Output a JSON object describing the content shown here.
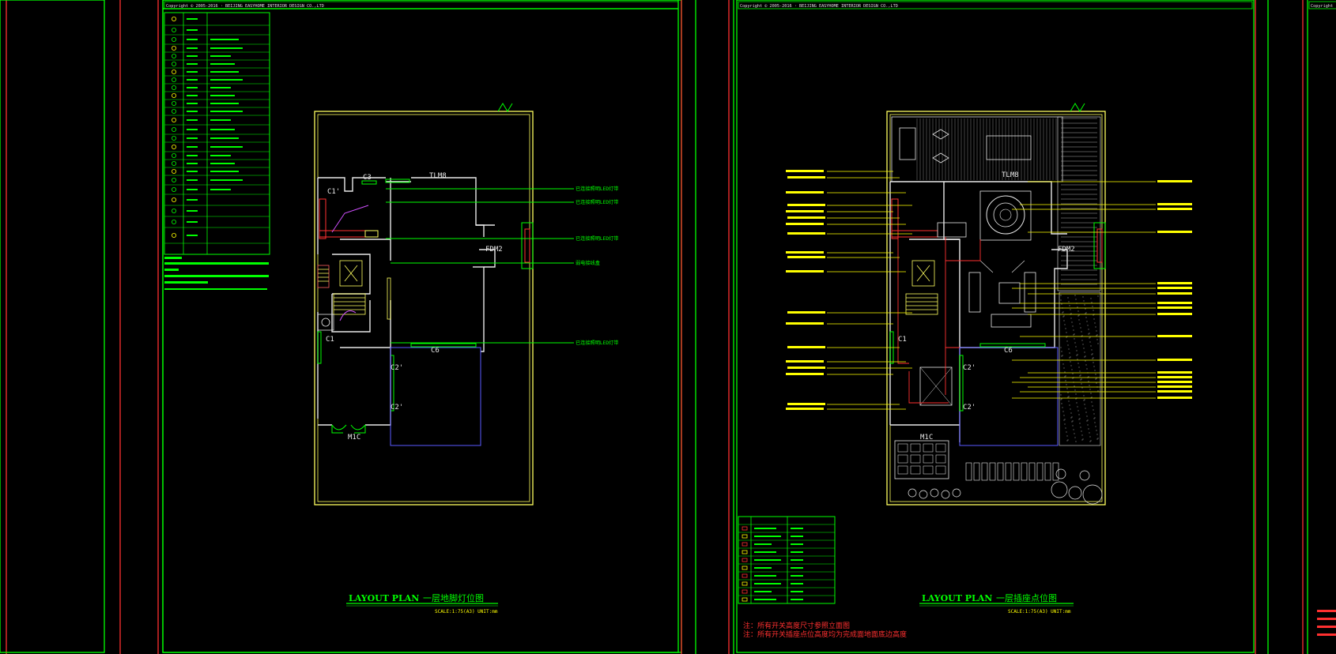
{
  "sheet_left": {
    "copyright": "Copyright ©  2005-2016 · BEIJING EASYHOME  INTERIOR DESIGN CO.,LTD",
    "title_en": "LAYOUT PLAN",
    "title_cn": "一层地脚灯位图",
    "scale": "SCALE:1:75(A3)  UNIT:mm",
    "room_labels": {
      "tlm8": "TLM8",
      "c3": "C3",
      "c1a": "C1'",
      "fdm2": "FDM2",
      "c1": "C1",
      "c6": "C6",
      "c2a": "C2'",
      "c2b": "C2'",
      "m1c": "M1C"
    },
    "callouts": [
      "已连接照明LED灯带",
      "已连接照明LED灯带",
      "已连接照明LED灯带",
      "弱电接线盒",
      "已连接照明LED灯带"
    ]
  },
  "sheet_right": {
    "copyright": "Copyright ©  2005-2016 · BEIJING EASYHOME  INTERIOR DESIGN CO.,LTD",
    "title_en": "LAYOUT PLAN",
    "title_cn": "一层插座点位图",
    "scale": "SCALE:1:75(A3)  UNIT:mm",
    "room_labels": {
      "tlm8": "TLM8",
      "fdm2": "FDM2",
      "c6": "C6",
      "c2a": "C2'",
      "c2b": "C2'",
      "m1c": "M1C",
      "c1": "C1"
    },
    "notes": [
      "注：所有开关高度尺寸参照立面图",
      "注：所有开关插座点位高度均为完成面地面底边高度"
    ]
  },
  "sheet_edge": {
    "copyright": "Copyright"
  },
  "colors": {
    "frame_green": "#00ff00",
    "frame_red": "#ff3030",
    "plan_yellow": "#ffff60",
    "wall_white": "#e8e8e8",
    "annotation_yellow": "#ffff00",
    "blue": "#5a5aff",
    "note_red": "#ff3030"
  }
}
